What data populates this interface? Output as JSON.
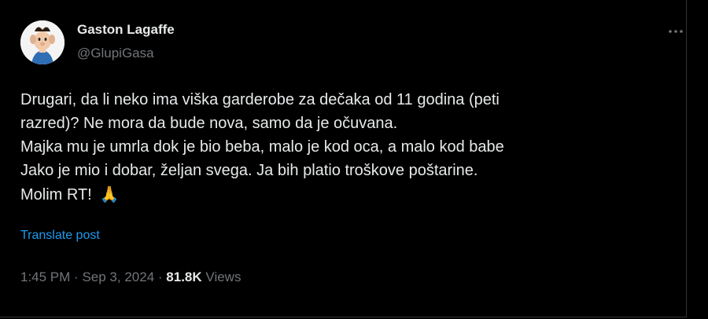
{
  "author": {
    "name": "Gaston Lagaffe",
    "handle": "@GlupiGasa"
  },
  "icons": {
    "more": "more-dots-icon",
    "pray": "folded-hands-emoji"
  },
  "tweet": {
    "lines": [
      "Drugari, da li neko ima viška garderobe za dečaka od 11 godina (peti",
      "razred)? Ne mora da bude nova, samo da je očuvana.",
      "Majka mu je umrla dok je bio beba, malo je kod oca, a malo kod babe",
      "Jako je mio i dobar, željan svega. Ja bih platio troškove poštarine.",
      "Molim RT!"
    ],
    "emoji": "🙏"
  },
  "translate_label": "Translate post",
  "meta": {
    "time": "1:45 PM",
    "separator": "·",
    "date": "Sep 3, 2024",
    "views_count": "81.8K",
    "views_label": "Views"
  },
  "colors": {
    "background": "#000000",
    "text": "#e7e9ea",
    "secondary": "#71767b",
    "link": "#1d9bf0"
  }
}
